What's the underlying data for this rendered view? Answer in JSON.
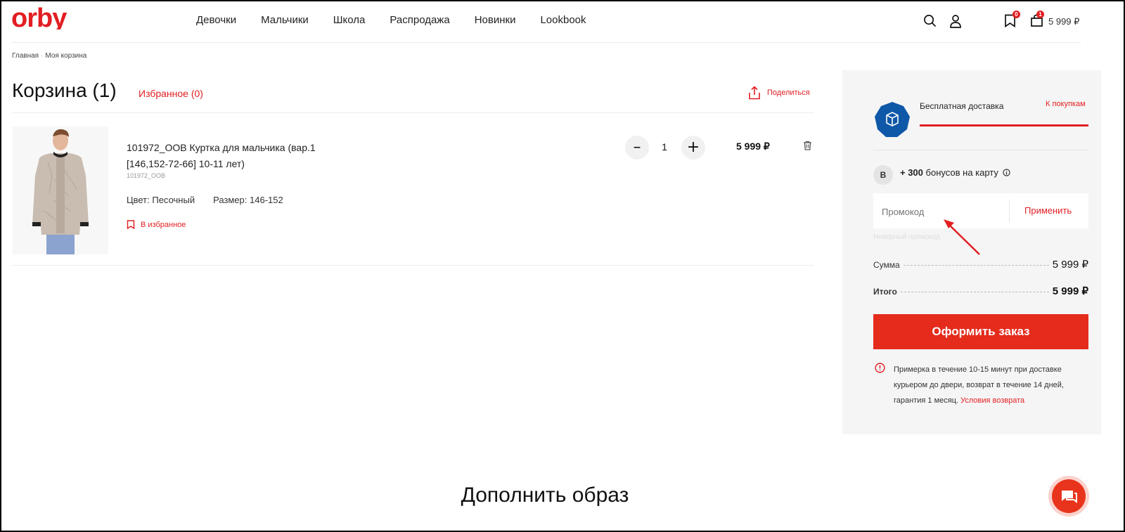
{
  "header": {
    "logo_text": "orby",
    "nav": [
      "Девочки",
      "Мальчики",
      "Школа",
      "Распродажа",
      "Новинки",
      "Lookbook"
    ],
    "favorites_count": "0",
    "cart_count": "1",
    "cart_total": "5 999 ₽"
  },
  "breadcrumbs": {
    "home": "Главная",
    "separator": "·",
    "current": "Моя корзина"
  },
  "cart": {
    "title": "Корзина (1)",
    "favorites_link": "Избранное (0)",
    "share_label": "Поделиться",
    "item": {
      "name": "101972_OOB Куртка для мальчика (вар.1 [146,152-72-66] 10-11 лет)",
      "sku": "101972_OOB",
      "color": "Цвет: Песочный",
      "size": "Размер: 146-152",
      "add_to_favorites": "В избранное",
      "quantity": "1",
      "minus": "–",
      "plus": "+",
      "price": "5 999 ₽"
    }
  },
  "summary": {
    "shipping_label": "Бесплатная доставка",
    "shipping_link": "К покупкам",
    "shipping_progress": 1.0,
    "bonus_badge": "B",
    "bonus_amount": "+ 300",
    "bonus_text": "бонусов на карту",
    "promo_placeholder": "Промокод",
    "promo_apply": "Применить",
    "promo_hint": "Неверный промокод",
    "sum_label": "Сумма",
    "sum_value": "5 999 ₽",
    "total_label": "Итого",
    "total_value": "5 999 ₽",
    "order_button": "Оформить заказ",
    "info_text": "Примерка в течение 10-15 минут при доставке курьером до двери, возврат в течение 14 дней, гарантия 1 месяц.",
    "info_link": "Условия возврата"
  },
  "recommend_title": "Дополнить образ",
  "colors": {
    "brand_red": "#e21e22",
    "shipping_badge_blue": "#0f58a8"
  }
}
